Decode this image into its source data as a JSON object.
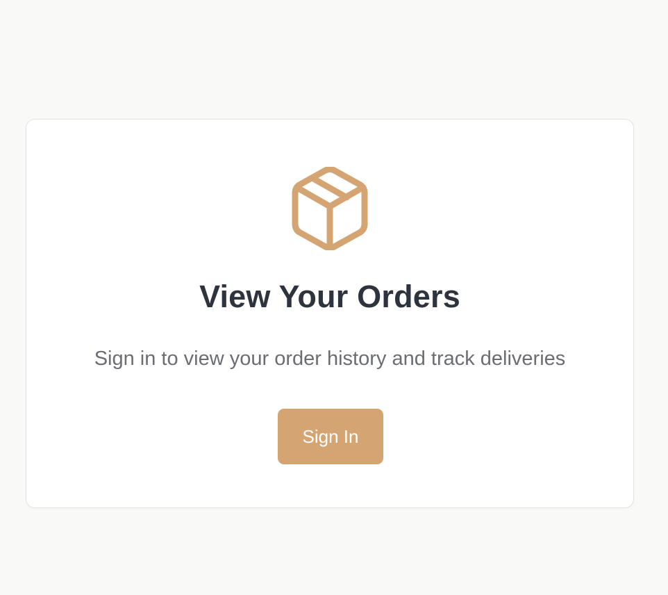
{
  "card": {
    "icon": "package-box-icon",
    "title": "View Your Orders",
    "subtitle": "Sign in to view your order history and track deliveries",
    "button_label": "Sign In"
  },
  "colors": {
    "page_background": "#f9f9f7",
    "card_background": "#ffffff",
    "accent": "#d4a572",
    "title_text": "#2e343d",
    "subtitle_text": "#6b6d72",
    "button_text": "#ffffff"
  }
}
